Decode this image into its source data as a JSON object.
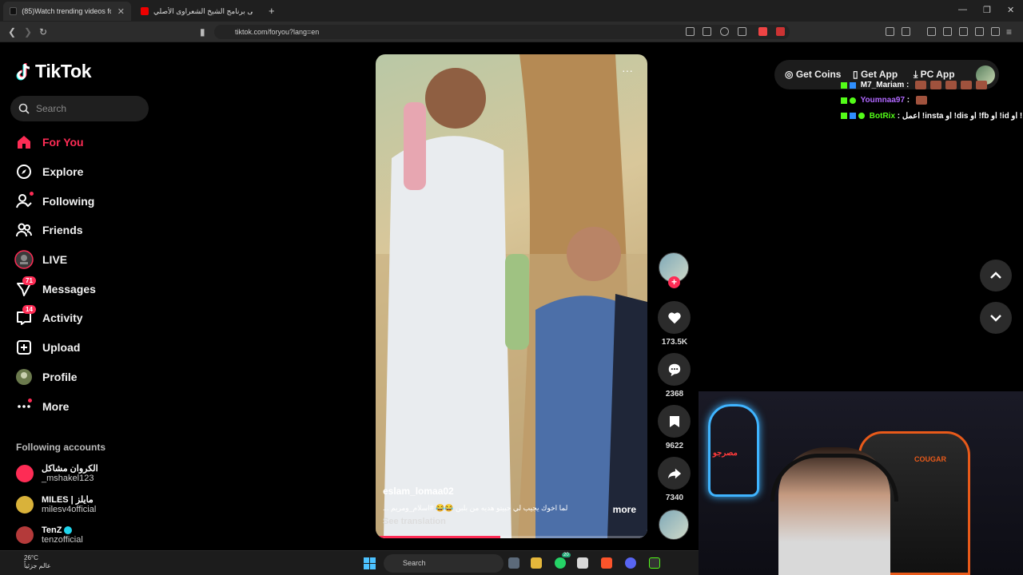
{
  "browser": {
    "tabs": [
      {
        "label": "(85)Watch trending videos fo"
      },
      {
        "label": "موسيقى برنامج الشيخ الشعراوى الأصلي"
      }
    ],
    "new_tab": "+",
    "url": "tiktok.com/foryou?lang=en"
  },
  "sidebar": {
    "logo": "TikTok",
    "search_placeholder": "Search",
    "items": [
      {
        "label": "For You",
        "icon": "home-icon"
      },
      {
        "label": "Explore",
        "icon": "compass-icon"
      },
      {
        "label": "Following",
        "icon": "following-icon"
      },
      {
        "label": "Friends",
        "icon": "friends-icon"
      },
      {
        "label": "LIVE",
        "icon": "live-icon"
      },
      {
        "label": "Messages",
        "icon": "messages-icon",
        "badge": "71"
      },
      {
        "label": "Activity",
        "icon": "activity-icon",
        "badge": "14"
      },
      {
        "label": "Upload",
        "icon": "upload-icon"
      },
      {
        "label": "Profile",
        "icon": "profile-icon"
      },
      {
        "label": "More",
        "icon": "more-icon"
      }
    ],
    "following_heading": "Following accounts",
    "accounts": [
      {
        "name": "الكروان مشاكل",
        "handle": "_mshakel123"
      },
      {
        "name": "MILES | مايلز",
        "handle": "milesv4official"
      },
      {
        "name": "TenZ",
        "handle": "tenzofficial"
      }
    ]
  },
  "top": {
    "coins": "Get Coins",
    "app": "Get App",
    "pc_app": "PC App"
  },
  "chat": [
    {
      "user": "M7_Mariam",
      "text": ":"
    },
    {
      "user": "Youmnaa97",
      "text": ":"
    },
    {
      "user": "BotRix",
      "text": ": اعمل !insta او !dis او !fb او !id او !"
    }
  ],
  "video": {
    "username": "eslam_lomaa02",
    "caption": "لما اخوك يجيب لي حبيتو هديه من بلبن 😂😂 #اسلام_ومريم ...",
    "more": "more",
    "see_translation": "See translation",
    "progress": 0.46
  },
  "actions": {
    "likes": "173.5K",
    "comments": "2368",
    "saves": "9622",
    "shares": "7340"
  },
  "taskbar": {
    "temp": "26°C",
    "weather_label": "عالم جزئياً",
    "search": "Search",
    "whatsapp_badge": "20"
  },
  "cam": {
    "neon_text": "مصرجو",
    "chair_brand": "COUGAR"
  },
  "colors": {
    "accent": "#fe2c55",
    "bg": "#000000"
  }
}
